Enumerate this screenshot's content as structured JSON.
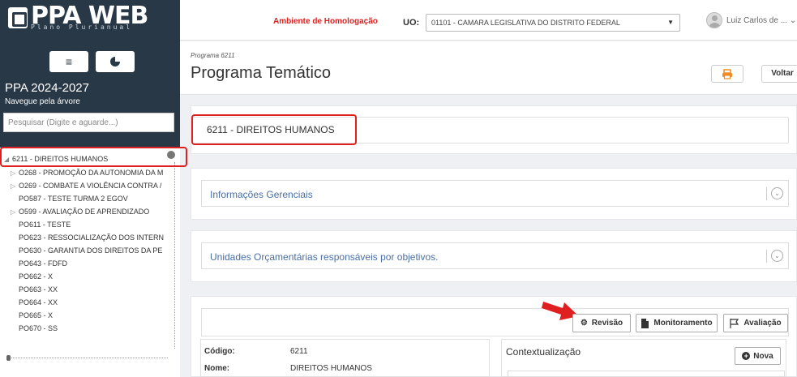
{
  "app": {
    "logo_text": "PPA WEB",
    "logo_sub": "Plano Plurianual"
  },
  "sidebar": {
    "menu_icon": "hamburger-icon",
    "chart_icon": "pie-chart-icon",
    "ppa_title": "PPA 2024-2027",
    "ppa_sub": "Navegue pela árvore",
    "search_placeholder": "Pesquisar (Digite e aguarde...)",
    "tree": [
      {
        "label": "6211 - DIREITOS HUMANOS",
        "expanded": true,
        "level": 0
      },
      {
        "label": "O268 - PROMOÇÃO DA AUTONOMIA DA M",
        "expandable": true,
        "level": 1
      },
      {
        "label": "O269 - COMBATE A VIOLÊNCIA CONTRA /",
        "expandable": true,
        "level": 1
      },
      {
        "label": "PO587 - TESTE TURMA 2 EGOV",
        "level": 1
      },
      {
        "label": "O599 - AVALIAÇÃO DE APRENDIZADO",
        "expandable": true,
        "level": 1
      },
      {
        "label": "PO611 - TESTE",
        "level": 1
      },
      {
        "label": "PO623 - RESSOCIALIZAÇÃO DOS INTERN",
        "level": 1
      },
      {
        "label": "PO630 - GARANTIA DOS DIREITOS DA PE",
        "level": 1
      },
      {
        "label": "PO643 - FDFD",
        "level": 1
      },
      {
        "label": "PO662 - X",
        "level": 1
      },
      {
        "label": "PO663 - XX",
        "level": 1
      },
      {
        "label": "PO664 - XX",
        "level": 1
      },
      {
        "label": "PO665 - X",
        "level": 1
      },
      {
        "label": "PO670 - SS",
        "level": 1
      }
    ]
  },
  "topbar": {
    "environment": "Ambiente de Homologação",
    "uo_label": "UO:",
    "uo_value": "01101 - CAMARA LEGISLATIVA DO DISTRITO FEDERAL",
    "username": "Luiz Carlos de ..."
  },
  "header": {
    "breadcrumb": "Programa 6211",
    "title": "Programa Temático",
    "print_icon": "printer-icon",
    "back_label": "Voltar"
  },
  "program": {
    "name": "6211 - DIREITOS HUMANOS"
  },
  "sections": [
    {
      "title": "Informações Gerenciais"
    },
    {
      "title": "Unidades Orçamentárias responsáveis por objetivos."
    }
  ],
  "toolbar": {
    "revisao": "Revisão",
    "monitoramento": "Monitoramento",
    "avaliacao": "Avaliação"
  },
  "details": {
    "codigo_label": "Código:",
    "codigo_value": "6211",
    "nome_label": "Nome:",
    "nome_value": "DIREITOS HUMANOS"
  },
  "contextualizacao": {
    "title": "Contextualização",
    "new_label": "Nova"
  },
  "colors": {
    "sidebar": "#283846",
    "highlight": "#e02020",
    "link": "#4a6fa5"
  }
}
